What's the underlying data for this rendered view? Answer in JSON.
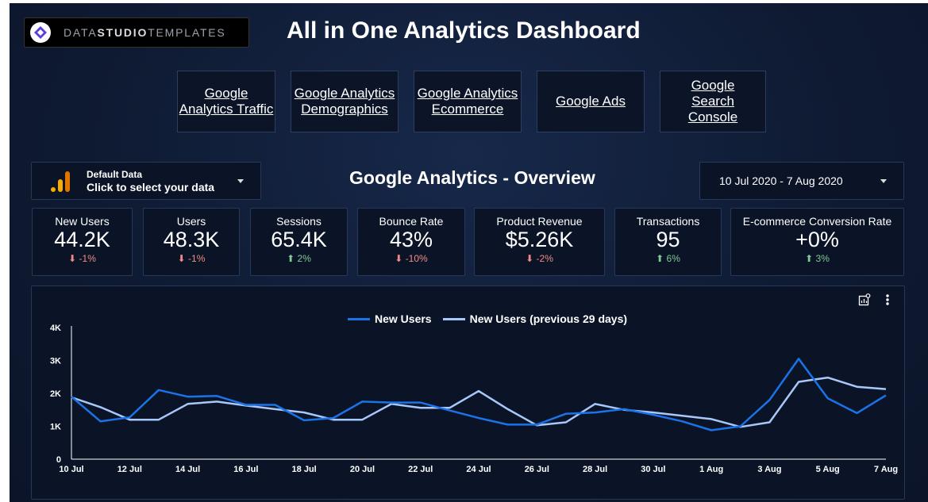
{
  "header": {
    "logo_text_light": "DATA",
    "logo_text_bold": "STUDIO",
    "logo_text_light2": "TEMPLATES",
    "title": "All in One Analytics Dashboard"
  },
  "nav": [
    {
      "label": "Google Analytics Traffic"
    },
    {
      "label": "Google Analytics Demographics"
    },
    {
      "label": "Google Analytics Ecommerce"
    },
    {
      "label": "Google Ads"
    },
    {
      "label": "Google Search Console"
    }
  ],
  "data_selector": {
    "line1": "Default Data",
    "line2": "Click to select your data",
    "icon": "bar-chart-icon"
  },
  "overview_title": "Google Analytics - Overview",
  "date_range": "10 Jul 2020 - 7 Aug 2020",
  "kpis": [
    {
      "label": "New Users",
      "value": "44.2K",
      "change": "-1%",
      "trend": "down"
    },
    {
      "label": "Users",
      "value": "48.3K",
      "change": "-1%",
      "trend": "down"
    },
    {
      "label": "Sessions",
      "value": "65.4K",
      "change": "2%",
      "trend": "up"
    },
    {
      "label": "Bounce Rate",
      "value": "43%",
      "change": "-10%",
      "trend": "down"
    },
    {
      "label": "Product Revenue",
      "value": "$5.26K",
      "change": "-2%",
      "trend": "down"
    },
    {
      "label": "Transactions",
      "value": "95",
      "change": "6%",
      "trend": "up"
    },
    {
      "label": "E-commerce Conversion Rate",
      "value": "+0%",
      "change": "3%",
      "trend": "up"
    }
  ],
  "colors": {
    "series1": "#1a73e8",
    "series2": "#a8c7fa",
    "down": "#f28b82",
    "up": "#81c995"
  },
  "chart_data": {
    "type": "line",
    "title": "",
    "xlabel": "",
    "ylabel": "",
    "ylim": [
      0,
      4000
    ],
    "y_ticks": [
      "0",
      "1K",
      "2K",
      "3K",
      "4K"
    ],
    "x_ticks": [
      "10 Jul",
      "12 Jul",
      "14 Jul",
      "16 Jul",
      "18 Jul",
      "20 Jul",
      "22 Jul",
      "24 Jul",
      "26 Jul",
      "28 Jul",
      "30 Jul",
      "1 Aug",
      "3 Aug",
      "5 Aug",
      "7 Aug"
    ],
    "x": [
      "10 Jul",
      "11 Jul",
      "12 Jul",
      "13 Jul",
      "14 Jul",
      "15 Jul",
      "16 Jul",
      "17 Jul",
      "18 Jul",
      "19 Jul",
      "20 Jul",
      "21 Jul",
      "22 Jul",
      "23 Jul",
      "24 Jul",
      "25 Jul",
      "26 Jul",
      "27 Jul",
      "28 Jul",
      "29 Jul",
      "30 Jul",
      "31 Jul",
      "1 Aug",
      "2 Aug",
      "3 Aug",
      "4 Aug",
      "5 Aug",
      "6 Aug",
      "7 Aug"
    ],
    "series": [
      {
        "name": "New Users",
        "values": [
          1900,
          1150,
          1270,
          2100,
          1900,
          1920,
          1650,
          1650,
          1180,
          1250,
          1750,
          1720,
          1720,
          1480,
          1250,
          1050,
          1050,
          1380,
          1420,
          1520,
          1350,
          1150,
          880,
          1000,
          1800,
          3050,
          1850,
          1400,
          1940
        ]
      },
      {
        "name": "New Users (previous 29 days)",
        "values": [
          1880,
          1580,
          1200,
          1200,
          1680,
          1750,
          1630,
          1520,
          1420,
          1200,
          1200,
          1680,
          1560,
          1560,
          2070,
          1520,
          1030,
          1120,
          1680,
          1500,
          1420,
          1320,
          1220,
          980,
          1120,
          2350,
          2480,
          2200,
          2130
        ]
      }
    ],
    "legend": "top-center",
    "grid": false
  }
}
